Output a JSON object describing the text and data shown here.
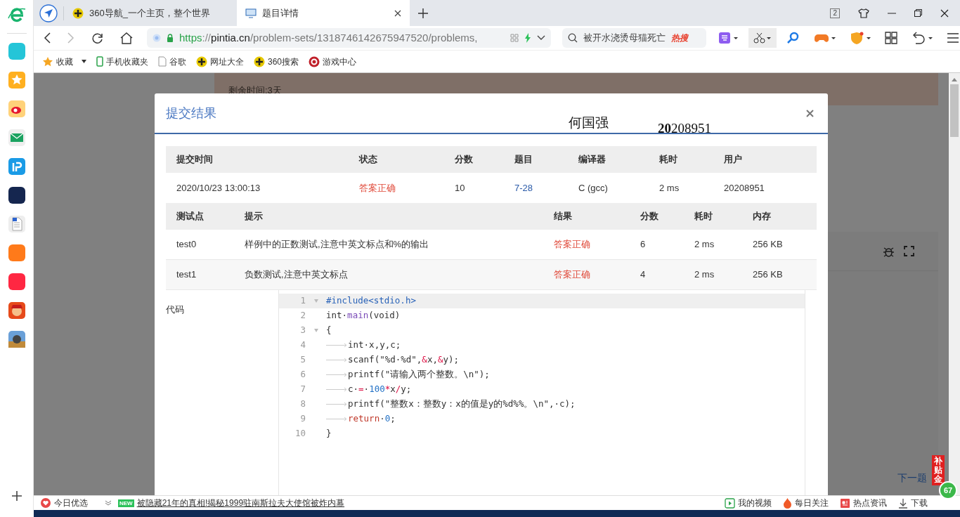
{
  "browser": {
    "tabs": [
      {
        "title": "360导航_一个主页，整个世界",
        "selected": false
      },
      {
        "title": "题目详情",
        "selected": true
      }
    ],
    "window_count": "2",
    "url": [
      {
        "text": "https",
        "kind": "scheme"
      },
      {
        "text": "://",
        "kind": "sep"
      },
      {
        "text": "pintia.cn",
        "kind": "host"
      },
      {
        "text": "/problem-sets/1318746142675947520/problems,",
        "kind": "path"
      }
    ],
    "search": {
      "value": "被开水浇烫母猫死亡",
      "badge": "热搜"
    },
    "bookmarks": [
      {
        "label": "收藏",
        "kind": "star"
      },
      {
        "label": "手机收藏夹",
        "kind": "phone"
      },
      {
        "label": "谷歌",
        "kind": "page"
      },
      {
        "label": "网址大全",
        "kind": "plus"
      },
      {
        "label": "360搜索",
        "kind": "plus"
      },
      {
        "label": "游戏中心",
        "kind": "game"
      }
    ]
  },
  "page": {
    "remaining": "剩余时间:3天",
    "next_link": "下一题"
  },
  "dialog": {
    "title": "提交结果",
    "name": "何国强",
    "student_id": "**20**208951",
    "summary": {
      "columns": [
        "提交时间",
        "状态",
        "分数",
        "题目",
        "编译器",
        "耗时",
        "用户"
      ],
      "row": [
        {
          "text": "2020/10/23 13:00:13",
          "kind": "plain"
        },
        {
          "text": "答案正确",
          "kind": "status"
        },
        {
          "text": "10",
          "kind": "plain"
        },
        {
          "text": "7-28",
          "kind": "link"
        },
        {
          "text": "C (gcc)",
          "kind": "plain"
        },
        {
          "text": "2 ms",
          "kind": "plain"
        },
        {
          "text": "20208951",
          "kind": "plain"
        }
      ]
    },
    "tests": {
      "columns": [
        "测试点",
        "提示",
        "结果",
        "分数",
        "耗时",
        "内存"
      ],
      "rows": [
        [
          "test0",
          "样例中的正数测试,注意中英文标点和%的输出",
          "答案正确",
          "6",
          "2 ms",
          "256 KB"
        ],
        [
          "test1",
          "负数测试,注意中英文标点",
          "答案正确",
          "4",
          "2 ms",
          "256 KB"
        ]
      ]
    },
    "code_label": "代码",
    "code": [
      {
        "number": "1",
        "fold": true,
        "indent": false,
        "active": true,
        "tokens": [
          {
            "text": "#include<stdio.h>",
            "kind": "pre"
          }
        ]
      },
      {
        "number": "2",
        "fold": false,
        "indent": false,
        "active": false,
        "tokens": [
          {
            "text": "int·",
            "kind": "plain"
          },
          {
            "text": "main",
            "kind": "func"
          },
          {
            "text": "(void)",
            "kind": "plain"
          }
        ]
      },
      {
        "number": "3",
        "fold": true,
        "indent": false,
        "active": false,
        "tokens": [
          {
            "text": "{",
            "kind": "plain"
          }
        ]
      },
      {
        "number": "4",
        "fold": false,
        "indent": true,
        "active": false,
        "tokens": [
          {
            "text": "int·x,y,c;",
            "kind": "plain"
          }
        ]
      },
      {
        "number": "5",
        "fold": false,
        "indent": true,
        "active": false,
        "tokens": [
          {
            "text": "scanf(\"%d·%d\",",
            "kind": "plain"
          },
          {
            "text": "&",
            "kind": "op"
          },
          {
            "text": "x,",
            "kind": "plain"
          },
          {
            "text": "&",
            "kind": "op"
          },
          {
            "text": "y);",
            "kind": "plain"
          }
        ]
      },
      {
        "number": "6",
        "fold": false,
        "indent": true,
        "active": false,
        "tokens": [
          {
            "text": "printf(\"请输入两个整数。\\n\");",
            "kind": "plain"
          }
        ]
      },
      {
        "number": "7",
        "fold": false,
        "indent": true,
        "active": false,
        "tokens": [
          {
            "text": "c·",
            "kind": "plain"
          },
          {
            "text": "=",
            "kind": "op"
          },
          {
            "text": "·",
            "kind": "plain"
          },
          {
            "text": "100",
            "kind": "num"
          },
          {
            "text": "*",
            "kind": "op"
          },
          {
            "text": "x",
            "kind": "plain"
          },
          {
            "text": "/",
            "kind": "op"
          },
          {
            "text": "y;",
            "kind": "plain"
          }
        ]
      },
      {
        "number": "8",
        "fold": false,
        "indent": true,
        "active": false,
        "tokens": [
          {
            "text": "printf(\"整数x：整数y：x的值是y的%d%%。\\n\",·c);",
            "kind": "plain"
          }
        ]
      },
      {
        "number": "9",
        "fold": false,
        "indent": true,
        "active": false,
        "tokens": [
          {
            "text": "return",
            "kind": "kw"
          },
          {
            "text": "·",
            "kind": "plain"
          },
          {
            "text": "0",
            "kind": "num"
          },
          {
            "text": ";",
            "kind": "plain"
          }
        ]
      },
      {
        "number": "10",
        "fold": false,
        "indent": false,
        "active": false,
        "tokens": [
          {
            "text": "}",
            "kind": "plain"
          }
        ]
      }
    ]
  },
  "status_bar": {
    "left": "今日优选",
    "badge": "NEW",
    "headline": "被隐藏21年的真相!揭秘1999驻南斯拉夫大使馆被炸内幕",
    "items": [
      {
        "label": "我的视频",
        "kind": "video"
      },
      {
        "label": "每日关注",
        "kind": "fire"
      },
      {
        "label": "热点资讯",
        "kind": "news"
      },
      {
        "label": "下载",
        "kind": "download"
      }
    ]
  },
  "floating": {
    "promo": "补贴金",
    "counter": "67"
  }
}
